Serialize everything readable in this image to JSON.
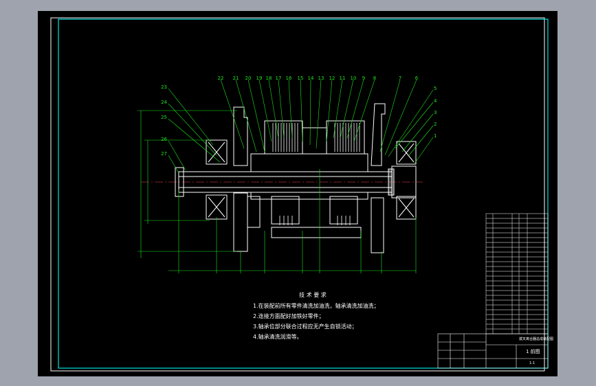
{
  "colors": {
    "background": "#9ea3ad",
    "sheet": "#000000",
    "frame": "#00e0e0",
    "part": "#ffffff",
    "dimension": "#1ee61e",
    "leader": "#1ee61e"
  },
  "balloons_top": [
    "22",
    "21",
    "20",
    "19",
    "18",
    "17",
    "16",
    "15",
    "14",
    "13",
    "12",
    "11",
    "10",
    "9",
    "8",
    "7",
    "6"
  ],
  "balloons_right": [
    "5",
    "4",
    "3",
    "2",
    "1"
  ],
  "balloons_left": [
    "23",
    "24",
    "25",
    "26",
    "27"
  ],
  "notes": {
    "title": "技 术 要 求",
    "lines": [
      "1.在装配前所有零件清洗加油洗，轴承清洗加油洗；",
      "2.连接方面配好加铁好零件；",
      "3.轴承位部分联合过程应无产生自锁活动；",
      "4.轴承清洗润滑等。"
    ]
  },
  "title_block": {
    "sheet_label": "1 前图",
    "scale_text": "1:1",
    "drawing_name": "拨叉离合器总成装配图"
  }
}
